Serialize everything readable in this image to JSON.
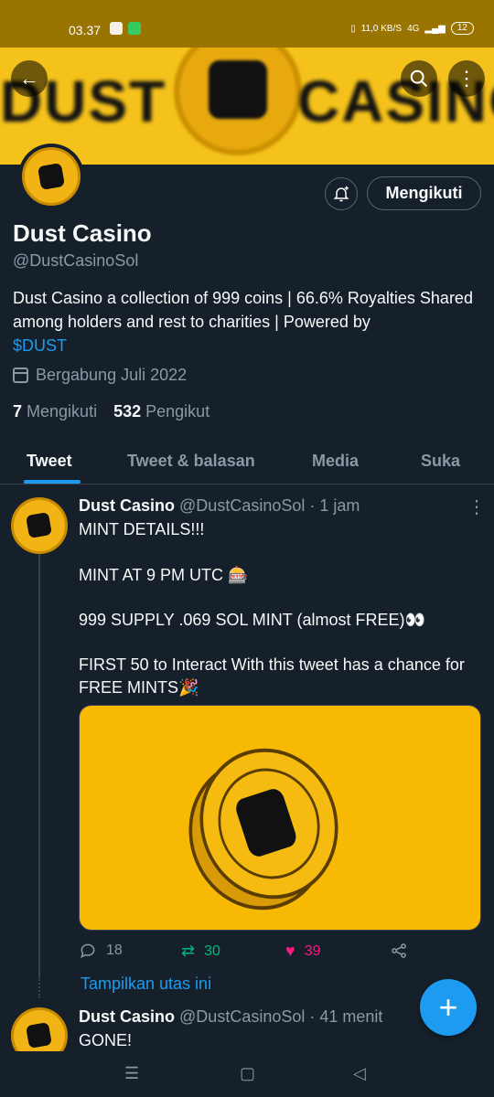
{
  "status_bar": {
    "time": "03.37",
    "net_speed": "11,0 KB/S",
    "network": "4G",
    "battery": "12"
  },
  "banner": {
    "text_left": "DUST",
    "text_right": "CASINO"
  },
  "profile": {
    "name": "Dust Casino",
    "handle": "@DustCasinoSol",
    "bio": "Dust Casino a collection of 999 coins | 66.6% Royalties Shared among holders and rest to charities | Powered by",
    "bio_link": "$DUST",
    "joined": "Bergabung Juli 2022",
    "following_count": "7",
    "following_label": "Mengikuti",
    "followers_count": "532",
    "followers_label": "Pengikut",
    "follow_button": "Mengikuti"
  },
  "tabs": [
    "Tweet",
    "Tweet & balasan",
    "Media",
    "Suka"
  ],
  "tweets": [
    {
      "name": "Dust Casino",
      "handle": "@DustCasinoSol",
      "time": "· 1 jam",
      "lines": [
        "MINT DETAILS!!!",
        "MINT AT 9 PM UTC 🎰",
        "999 SUPPLY .069 SOL MINT (almost FREE)👀",
        "FIRST 50 to Interact With this tweet has a chance for FREE MINTS🎉"
      ],
      "replies": "18",
      "retweets": "30",
      "likes": "39"
    },
    {
      "name": "Dust Casino",
      "handle": "@DustCasinoSol",
      "time": "· 41 menit",
      "text": "GONE!"
    }
  ],
  "show_thread": "Tampilkan utas ini",
  "colors": {
    "background": "#15202b",
    "accent": "#1d9bf0",
    "banner": "#f5c21b",
    "retweet": "#00ba7c",
    "like": "#f91880"
  }
}
